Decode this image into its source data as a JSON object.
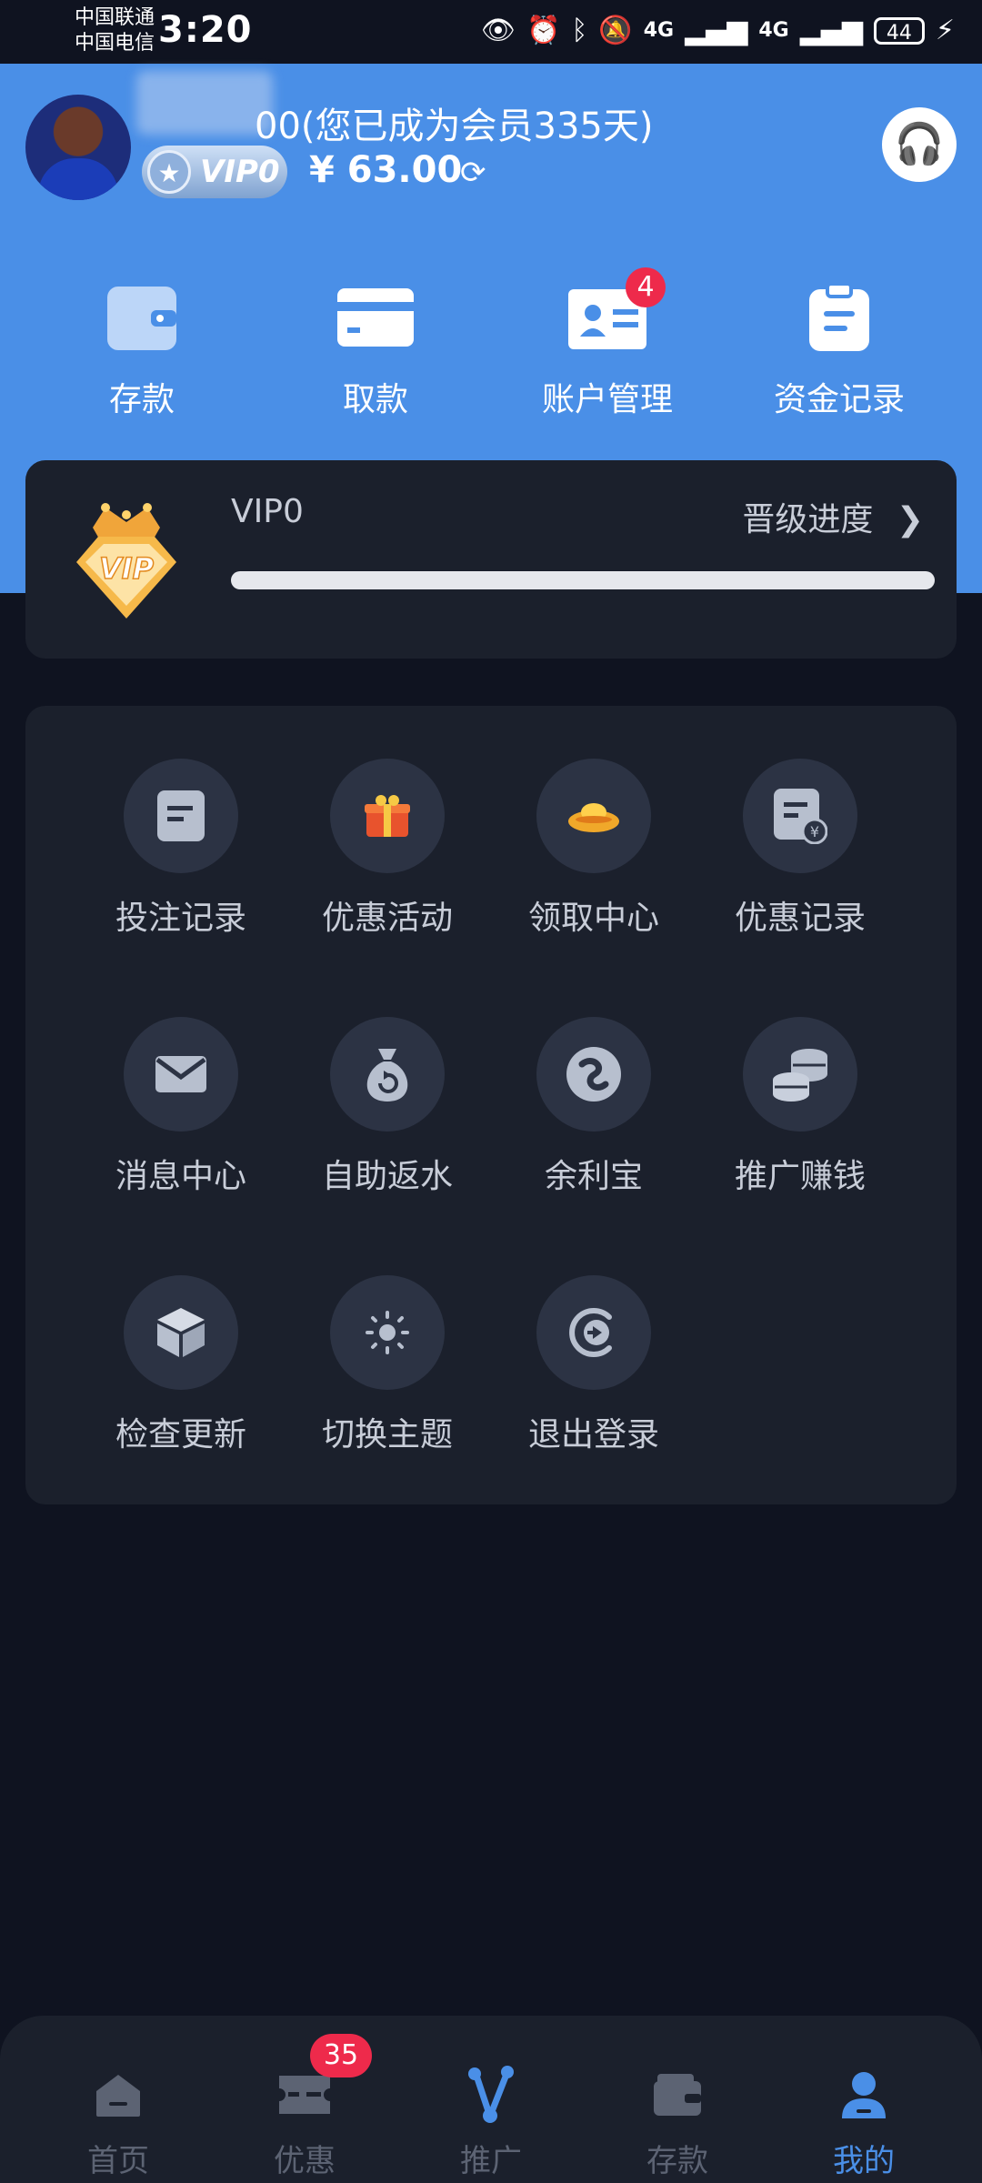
{
  "status_bar": {
    "carrier_1": "中国联通",
    "carrier_2": "中国电信",
    "time": "3:20",
    "signal_1": "4G",
    "signal_2": "4G",
    "battery": "44"
  },
  "profile": {
    "member_text": "00(您已成为会员335天)",
    "vip_badge": "VIP0",
    "balance": "¥ 63.00"
  },
  "quick_actions": [
    {
      "label": "存款",
      "icon": "wallet-icon"
    },
    {
      "label": "取款",
      "icon": "card-icon"
    },
    {
      "label": "账户管理",
      "icon": "id-card-icon",
      "badge": "4"
    },
    {
      "label": "资金记录",
      "icon": "clipboard-icon"
    }
  ],
  "vip_card": {
    "level": "VIP0",
    "upgrade_label": "晋级进度",
    "progress_fraction": 0
  },
  "grid_items": [
    {
      "label": "投注记录",
      "icon": "document-icon"
    },
    {
      "label": "优惠活动",
      "icon": "gift-icon"
    },
    {
      "label": "领取中心",
      "icon": "gold-ingot-icon"
    },
    {
      "label": "优惠记录",
      "icon": "yen-document-icon"
    },
    {
      "label": "消息中心",
      "icon": "envelope-icon"
    },
    {
      "label": "自助返水",
      "icon": "money-bag-icon"
    },
    {
      "label": "余利宝",
      "icon": "swirl-icon"
    },
    {
      "label": "推广赚钱",
      "icon": "coins-icon"
    },
    {
      "label": "检查更新",
      "icon": "cube-icon"
    },
    {
      "label": "切换主题",
      "icon": "sun-icon"
    },
    {
      "label": "退出登录",
      "icon": "logout-icon"
    }
  ],
  "bottom_nav": [
    {
      "label": "首页",
      "icon": "home-icon"
    },
    {
      "label": "优惠",
      "icon": "ticket-icon",
      "badge": "35"
    },
    {
      "label": "推广",
      "icon": "share-icon"
    },
    {
      "label": "存款",
      "icon": "wallet-icon"
    },
    {
      "label": "我的",
      "icon": "user-icon",
      "active": true
    }
  ],
  "colors": {
    "primary": "#4a8fe7",
    "background": "#0f1320",
    "card": "#1b202c",
    "icon_circle": "#2c3344",
    "badge": "#ee2a4b"
  }
}
